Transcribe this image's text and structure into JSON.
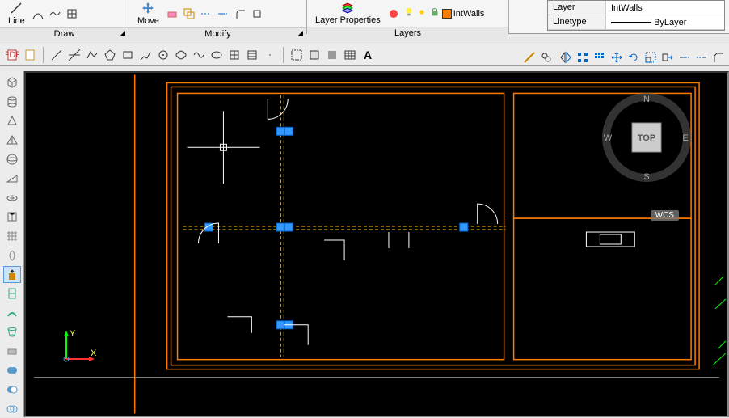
{
  "ribbon": {
    "draw": {
      "label": "Draw",
      "line": "Line"
    },
    "modify": {
      "label": "Modify",
      "move": "Move"
    },
    "layers": {
      "label": "Layers",
      "layerprops": "Layer\nProperties",
      "current": "IntWalls"
    }
  },
  "props": {
    "layer": {
      "label": "Layer",
      "value": "IntWalls"
    },
    "linetype": {
      "label": "Linetype",
      "value": "ByLayer"
    }
  },
  "viewcube": {
    "top": "TOP",
    "n": "N",
    "s": "S",
    "e": "E",
    "w": "W"
  },
  "wcs": "WCS"
}
